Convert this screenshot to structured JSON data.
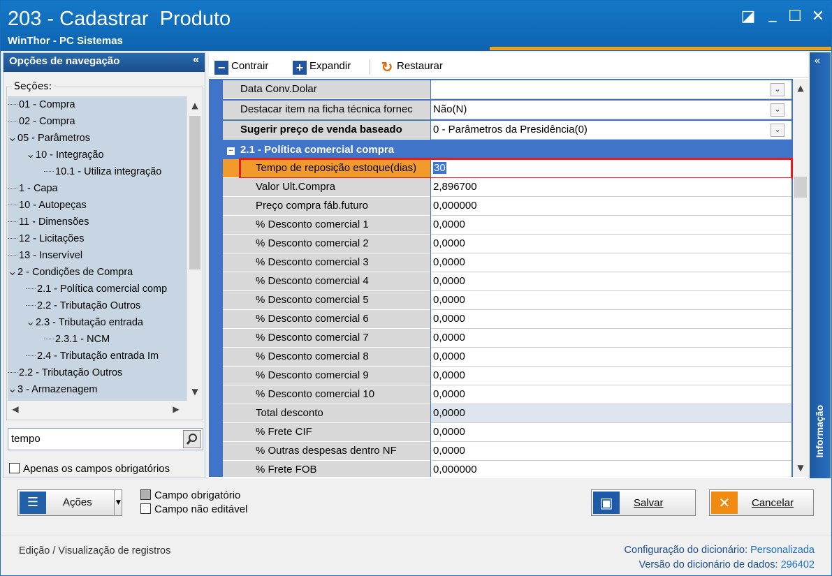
{
  "window": {
    "title": "203 - Cadastrar  Produto",
    "subtitle": "WinThor - PC Sistemas",
    "controls": {
      "restore": "◪",
      "minimize": "_",
      "maximize": "☐",
      "close": "✕"
    }
  },
  "nav": {
    "header": "Opções de navegação",
    "collapse": "«",
    "sections_label": "Seções:",
    "tree": [
      {
        "label": "01 - Compra",
        "level": 0,
        "exp": ""
      },
      {
        "label": "02 - Compra",
        "level": 0,
        "exp": ""
      },
      {
        "label": "05 - Parâmetros",
        "level": 0,
        "exp": "v"
      },
      {
        "label": "10 - Integração",
        "level": 1,
        "exp": "v"
      },
      {
        "label": "10.1 - Utiliza integração",
        "level": 2,
        "exp": ""
      },
      {
        "label": "1 - Capa",
        "level": 0,
        "exp": ""
      },
      {
        "label": "10 - Autopeças",
        "level": 0,
        "exp": ""
      },
      {
        "label": "11 - Dimensões",
        "level": 0,
        "exp": ""
      },
      {
        "label": "12 - Licitações",
        "level": 0,
        "exp": ""
      },
      {
        "label": "13 - Inservível",
        "level": 0,
        "exp": ""
      },
      {
        "label": "2 - Condições de Compra",
        "level": 0,
        "exp": "v"
      },
      {
        "label": "2.1 - Política comercial comp",
        "level": 1,
        "exp": ""
      },
      {
        "label": "2.2 - Tributação Outros",
        "level": 1,
        "exp": ""
      },
      {
        "label": "2.3 - Tributação entrada",
        "level": 1,
        "exp": "v"
      },
      {
        "label": "2.3.1 - NCM",
        "level": 2,
        "exp": ""
      },
      {
        "label": "2.4 - Tributação entrada Im",
        "level": 1,
        "exp": ""
      },
      {
        "label": "2.2 - Tributação Outros",
        "level": 0,
        "exp": ""
      },
      {
        "label": "3 - Armazenagem",
        "level": 0,
        "exp": "v"
      }
    ],
    "search_value": "tempo",
    "required_only_label": "Apenas os campos obrigatórios"
  },
  "toolbar": {
    "collapse": "Contrair",
    "expand": "Expandir",
    "restore": "Restaurar"
  },
  "properties": {
    "top_rows": [
      {
        "name": "Data Conv.Dolar",
        "value": "",
        "dropdown": true,
        "bold": false
      },
      {
        "name": "Destacar item na ficha técnica fornec",
        "value": "Não(N)",
        "dropdown": true,
        "bold": false
      },
      {
        "name": "Sugerir preço de venda baseado",
        "value": "0 - Parâmetros da Presidência(0)",
        "dropdown": true,
        "bold": true
      }
    ],
    "group_label": "2.1 - Política comercial compra",
    "group_toggle": "−",
    "selected": {
      "name": "Tempo de reposição estoque(dias)",
      "value": "30"
    },
    "rows": [
      {
        "name": "Valor Ult.Compra",
        "value": "2,896700"
      },
      {
        "name": "Preço compra fáb.futuro",
        "value": "0,000000"
      },
      {
        "name": "% Desconto comercial 1",
        "value": "0,0000"
      },
      {
        "name": "% Desconto comercial 2",
        "value": "0,0000"
      },
      {
        "name": "% Desconto comercial 3",
        "value": "0,0000"
      },
      {
        "name": "% Desconto comercial 4",
        "value": "0,0000"
      },
      {
        "name": "% Desconto comercial 5",
        "value": "0,0000"
      },
      {
        "name": "% Desconto comercial 6",
        "value": "0,0000"
      },
      {
        "name": "% Desconto comercial 7",
        "value": "0,0000"
      },
      {
        "name": "% Desconto comercial 8",
        "value": "0,0000"
      },
      {
        "name": "% Desconto comercial 9",
        "value": "0,0000"
      },
      {
        "name": "% Desconto comercial 10",
        "value": "0,0000"
      },
      {
        "name": "Total desconto",
        "value": "0,0000",
        "readonly": true
      },
      {
        "name": "% Frete CIF",
        "value": "0,0000"
      },
      {
        "name": "% Outras despesas dentro NF",
        "value": "0,0000"
      },
      {
        "name": "% Frete FOB",
        "value": "0,000000"
      }
    ]
  },
  "info_panel": {
    "label": "Informação",
    "collapse": "«"
  },
  "actions": {
    "acoes_label": "Ações",
    "legend_required": "Campo obrigatório",
    "legend_readonly": "Campo não editável",
    "save_label": "Salvar",
    "cancel_label": "Cancelar"
  },
  "status": {
    "left": "Edição / Visualização de registros",
    "dict_config_label": "Configuração do dicionário:",
    "dict_config_value": "Personalizada",
    "dict_version_label": "Versão do dicionário de dados:",
    "dict_version_value": "296402"
  },
  "colors": {
    "accent": "#1478c8",
    "highlight_orange": "#f39a2c",
    "selection_border": "#e02020",
    "grid_blue": "#3f74c8"
  }
}
